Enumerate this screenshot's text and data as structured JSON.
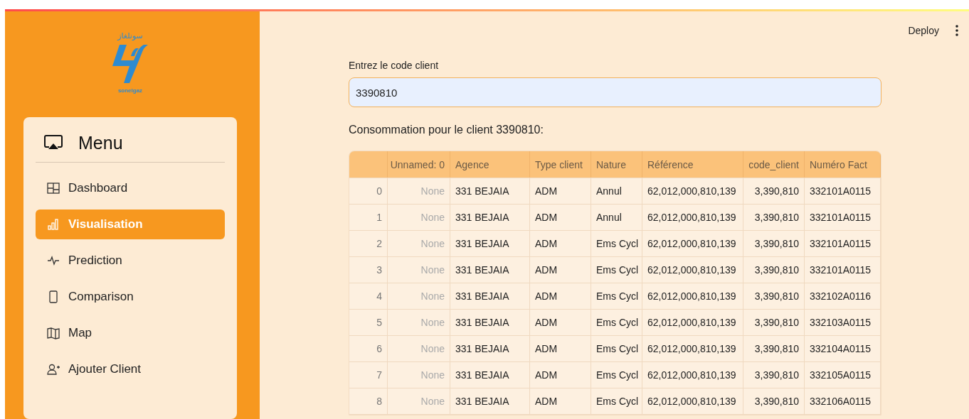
{
  "sidebar": {
    "logo": {
      "arabic_text": "سونلغاز",
      "latin_text": "sonelgaz"
    },
    "menu": {
      "title": "Menu",
      "items": [
        {
          "label": "Dashboard",
          "selected": false
        },
        {
          "label": "Visualisation",
          "selected": true
        },
        {
          "label": "Prediction",
          "selected": false
        },
        {
          "label": "Comparison",
          "selected": false
        },
        {
          "label": "Map",
          "selected": false
        },
        {
          "label": "Ajouter Client",
          "selected": false
        }
      ]
    }
  },
  "header": {
    "deploy": "Deploy"
  },
  "form": {
    "label": "Entrez le code client",
    "value": "3390810"
  },
  "caption": "Consommation pour le client 3390810:",
  "table": {
    "columns": [
      {
        "label": "Unnamed: 0",
        "kind": "missing"
      },
      {
        "label": "Agence",
        "kind": "text"
      },
      {
        "label": "Type client",
        "kind": "text"
      },
      {
        "label": "Nature",
        "kind": "text"
      },
      {
        "label": "Référence",
        "kind": "text"
      },
      {
        "label": "code_client",
        "kind": "number"
      },
      {
        "label": "Numéro Fact",
        "kind": "text"
      }
    ],
    "rows": [
      {
        "index": "0",
        "cells": [
          "None",
          "331 BEJAIA",
          "ADM",
          "Annul",
          "62,012,000,810,139",
          "3,390,810",
          "332101A0115"
        ]
      },
      {
        "index": "1",
        "cells": [
          "None",
          "331 BEJAIA",
          "ADM",
          "Annul",
          "62,012,000,810,139",
          "3,390,810",
          "332101A0115"
        ]
      },
      {
        "index": "2",
        "cells": [
          "None",
          "331 BEJAIA",
          "ADM",
          "Ems Cycl",
          "62,012,000,810,139",
          "3,390,810",
          "332101A0115"
        ]
      },
      {
        "index": "3",
        "cells": [
          "None",
          "331 BEJAIA",
          "ADM",
          "Ems Cycl",
          "62,012,000,810,139",
          "3,390,810",
          "332101A0115"
        ]
      },
      {
        "index": "4",
        "cells": [
          "None",
          "331 BEJAIA",
          "ADM",
          "Ems Cycl",
          "62,012,000,810,139",
          "3,390,810",
          "332102A0116"
        ]
      },
      {
        "index": "5",
        "cells": [
          "None",
          "331 BEJAIA",
          "ADM",
          "Ems Cycl",
          "62,012,000,810,139",
          "3,390,810",
          "332103A0115"
        ]
      },
      {
        "index": "6",
        "cells": [
          "None",
          "331 BEJAIA",
          "ADM",
          "Ems Cycl",
          "62,012,000,810,139",
          "3,390,810",
          "332104A0115"
        ]
      },
      {
        "index": "7",
        "cells": [
          "None",
          "331 BEJAIA",
          "ADM",
          "Ems Cycl",
          "62,012,000,810,139",
          "3,390,810",
          "332105A0115"
        ]
      },
      {
        "index": "8",
        "cells": [
          "None",
          "331 BEJAIA",
          "ADM",
          "Ems Cycl",
          "62,012,000,810,139",
          "3,390,810",
          "332106A0115"
        ]
      }
    ]
  }
}
